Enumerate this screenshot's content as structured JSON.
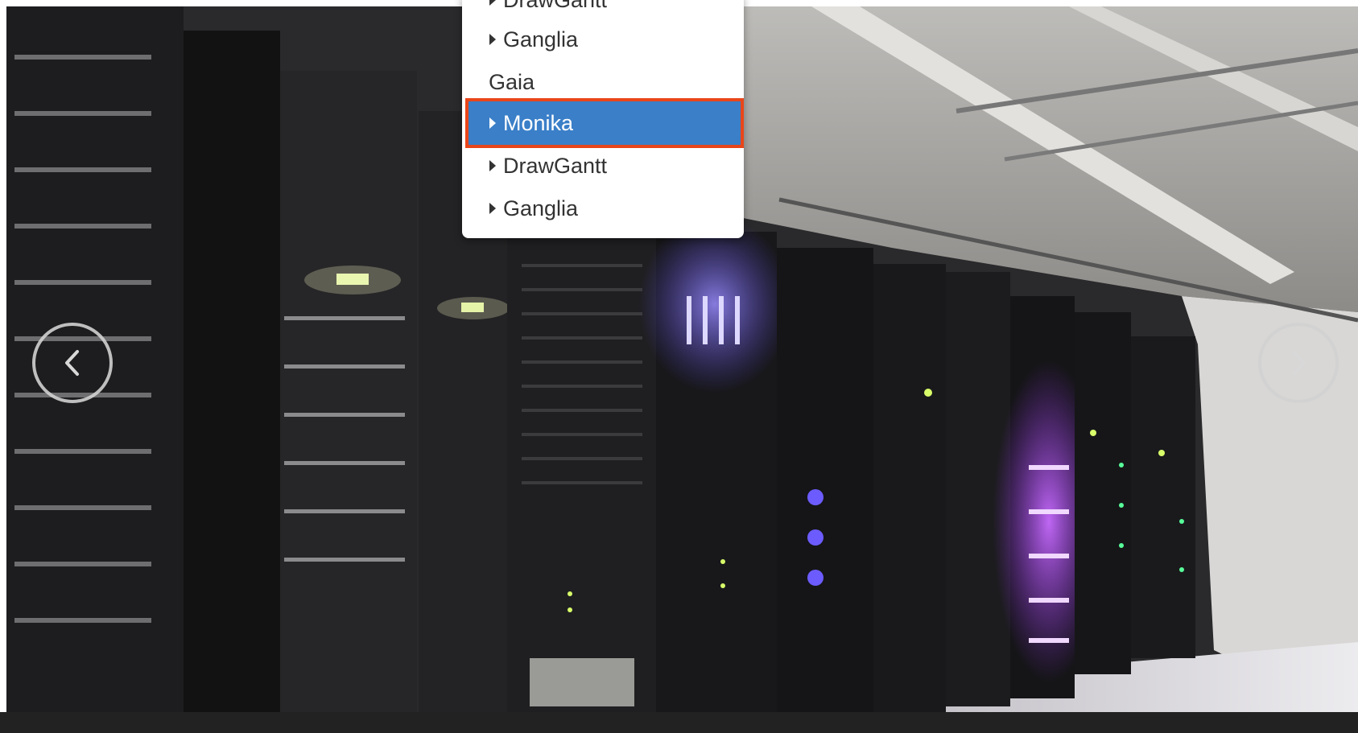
{
  "dropdown": {
    "items": [
      {
        "label": "DrawGantt",
        "type": "submenu",
        "partially_visible": true
      },
      {
        "label": "Ganglia",
        "type": "submenu"
      },
      {
        "label": "Gaia",
        "type": "header"
      },
      {
        "label": "Monika",
        "type": "submenu",
        "active": true,
        "highlight_color": "#3a7fc8",
        "outline_color": "#e8461a"
      },
      {
        "label": "DrawGantt",
        "type": "submenu"
      },
      {
        "label": "Ganglia",
        "type": "submenu"
      }
    ]
  },
  "carousel": {
    "image": "server-racks-datacenter",
    "prev_icon": "chevron-left-icon",
    "next_icon": "chevron-right-icon"
  },
  "colors": {
    "menu_active_bg": "#3a7fc8",
    "menu_active_outline": "#e8461a",
    "menu_text": "#333333",
    "control_ring": "#d2d2d2"
  }
}
